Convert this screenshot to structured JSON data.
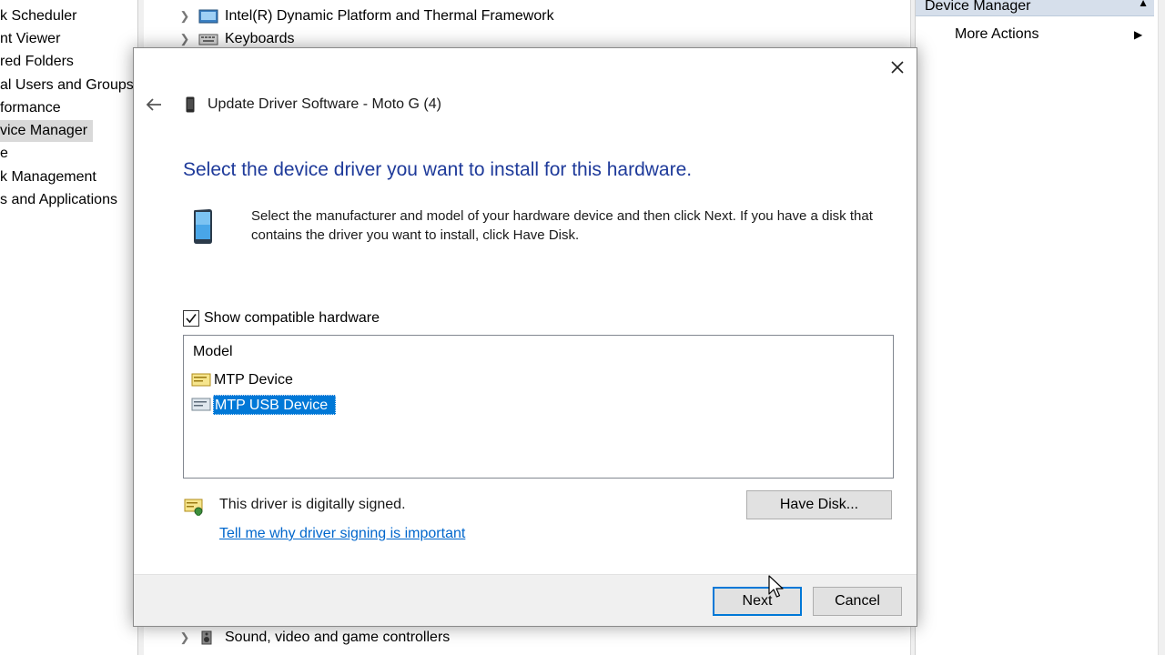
{
  "background": {
    "left_pane_items": [
      {
        "label": "k Scheduler",
        "selected": false
      },
      {
        "label": "nt Viewer",
        "selected": false
      },
      {
        "label": "red Folders",
        "selected": false
      },
      {
        "label": "al Users and Groups",
        "selected": false
      },
      {
        "label": "formance",
        "selected": false
      },
      {
        "label": "vice Manager",
        "selected": true
      },
      {
        "label": "e",
        "selected": false
      },
      {
        "label": "k Management",
        "selected": false
      },
      {
        "label": "s and Applications",
        "selected": false
      }
    ],
    "tree_items": {
      "intel": "Intel(R) Dynamic Platform and Thermal Framework",
      "keyboards": "Keyboards",
      "sound": "Sound, video and game controllers"
    },
    "actions": {
      "header": "Device Manager",
      "more_actions": "More Actions"
    }
  },
  "dialog": {
    "title": "Update Driver Software - Moto G (4)",
    "heading": "Select the device driver you want to install for this hardware.",
    "instructions": "Select the manufacturer and model of your hardware device and then click Next. If you have a disk that contains the driver you want to install, click Have Disk.",
    "show_compatible_label": "Show compatible hardware",
    "show_compatible_checked": true,
    "model_header": "Model",
    "models": [
      {
        "label": "MTP Device",
        "selected": false
      },
      {
        "label": "MTP USB Device",
        "selected": true
      }
    ],
    "signed_text": "This driver is digitally signed.",
    "signing_link": "Tell me why driver signing is important",
    "have_disk_label": "Have Disk...",
    "next_label": "Next",
    "cancel_label": "Cancel"
  },
  "icons": {
    "close": "close-icon",
    "back": "back-arrow-icon",
    "phone": "phone-icon",
    "driver": "driver-icon",
    "certificate": "certificate-icon"
  },
  "colors": {
    "heading": "#1e3a9a",
    "selection": "#0078d7",
    "link": "#0066cc",
    "footer": "#f0f0f0"
  }
}
